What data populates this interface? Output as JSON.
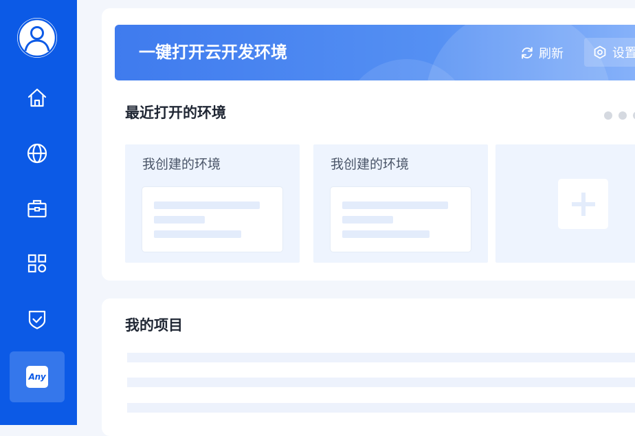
{
  "sidebar": {
    "items": [
      {
        "icon": "home-icon"
      },
      {
        "icon": "globe-icon"
      },
      {
        "icon": "briefcase-icon"
      },
      {
        "icon": "apps-icon"
      },
      {
        "icon": "shield-check-icon"
      },
      {
        "icon": "any-app-icon",
        "label": "Any",
        "active": true
      }
    ]
  },
  "banner": {
    "title": "一键打开云开发环境",
    "refresh_label": "刷新",
    "settings_label": "设置"
  },
  "recent": {
    "title": "最近打开的环境",
    "cards": [
      {
        "label": "我创建的环境"
      },
      {
        "label": "我创建的环境"
      }
    ]
  },
  "projects": {
    "title": "我的项目"
  },
  "colors": {
    "sidebar": "#0c5ae6",
    "sidebar_active": "#3577eb",
    "banner_start": "#3f7bee",
    "banner_end": "#8ab4fa",
    "page_bg": "#f3f6fc"
  }
}
